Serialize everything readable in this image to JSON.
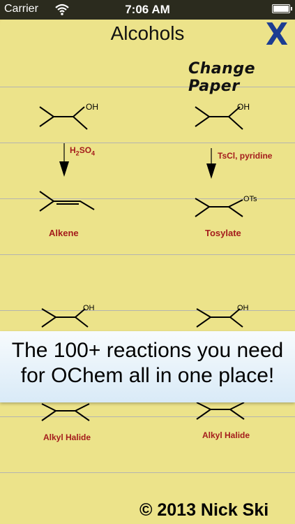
{
  "status_bar": {
    "carrier": "Carrier",
    "time": "7:06 AM"
  },
  "header": {
    "title": "Alcohols",
    "close_icon": "x-icon",
    "change_paper": "Change Paper"
  },
  "reactions": {
    "left_top": {
      "reactant_group": "OH",
      "reagent_h": "H",
      "reagent_sub1": "2",
      "reagent_so": "SO",
      "reagent_sub2": "4",
      "product_label": "Alkene"
    },
    "right_top": {
      "reactant_group": "OH",
      "reagent": "TsCl, pyridine",
      "product_group": "OTs",
      "product_label": "Tosylate"
    },
    "left_bottom": {
      "reactant_group": "OH",
      "product_label": "Alkyl Halide"
    },
    "right_bottom": {
      "reactant_group": "OH",
      "product_label": "Alkyl Halide"
    }
  },
  "banner": {
    "line1": "The 100+ reactions you need",
    "line2": "for OChem all in one place!"
  },
  "footer": {
    "copyright": "© 2013 Nick Ski"
  },
  "colors": {
    "paper": "#ece38a",
    "label_red": "#a41c1c",
    "close_blue": "#1c3d92"
  }
}
